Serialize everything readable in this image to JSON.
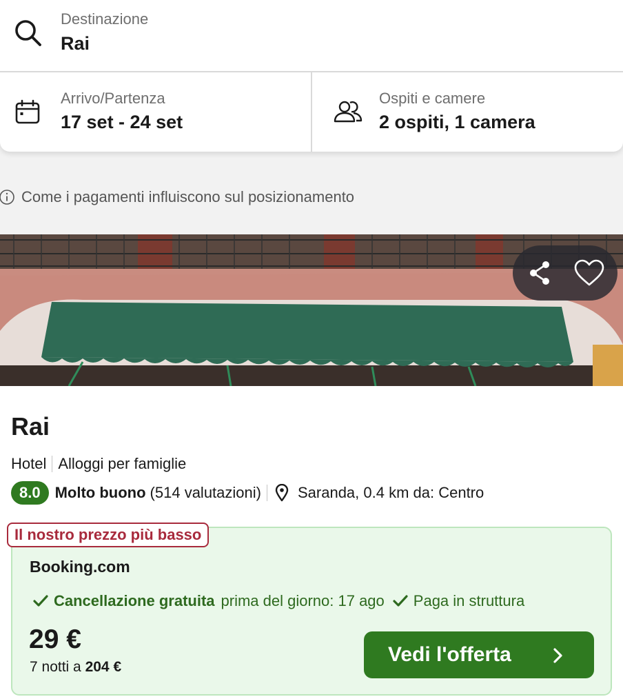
{
  "search": {
    "destination_label": "Destinazione",
    "destination_value": "Rai",
    "dates_label": "Arrivo/Partenza",
    "dates_value": "17 set - 24 set",
    "guests_label": "Ospiti e camere",
    "guests_value": "2 ospiti, 1 camera"
  },
  "payment_info": "Come i pagamenti influiscono sul posizionamento",
  "hotel": {
    "name": "Rai",
    "type": "Hotel",
    "category": "Alloggi per famiglie",
    "score": "8.0",
    "rating_word": "Molto buono",
    "rating_count": "(514 valutazioni)",
    "location": "Saranda, 0.4 km da: Centro"
  },
  "deal": {
    "tag": "Il nostro prezzo più basso",
    "provider": "Booking.com",
    "perk_bold": "Cancellazione gratuita",
    "perk_rest": "prima del giorno: 17 ago",
    "perk2": "Paga in struttura",
    "price": "29 €",
    "nights_prefix": "7 notti a",
    "nights_total": "204 €",
    "cta": "Vedi l'offerta"
  },
  "icons": {
    "search": "search-icon",
    "calendar": "calendar-icon",
    "guests": "guests-icon",
    "info": "info-icon",
    "share": "share-icon",
    "favorite": "heart-icon",
    "location": "location-pin-icon",
    "check": "check-icon",
    "chevron": "chevron-right-icon"
  },
  "colors": {
    "accent_green": "#2f7a20",
    "deal_background": "#eaf8ea",
    "tag_red": "#a82a3c"
  }
}
